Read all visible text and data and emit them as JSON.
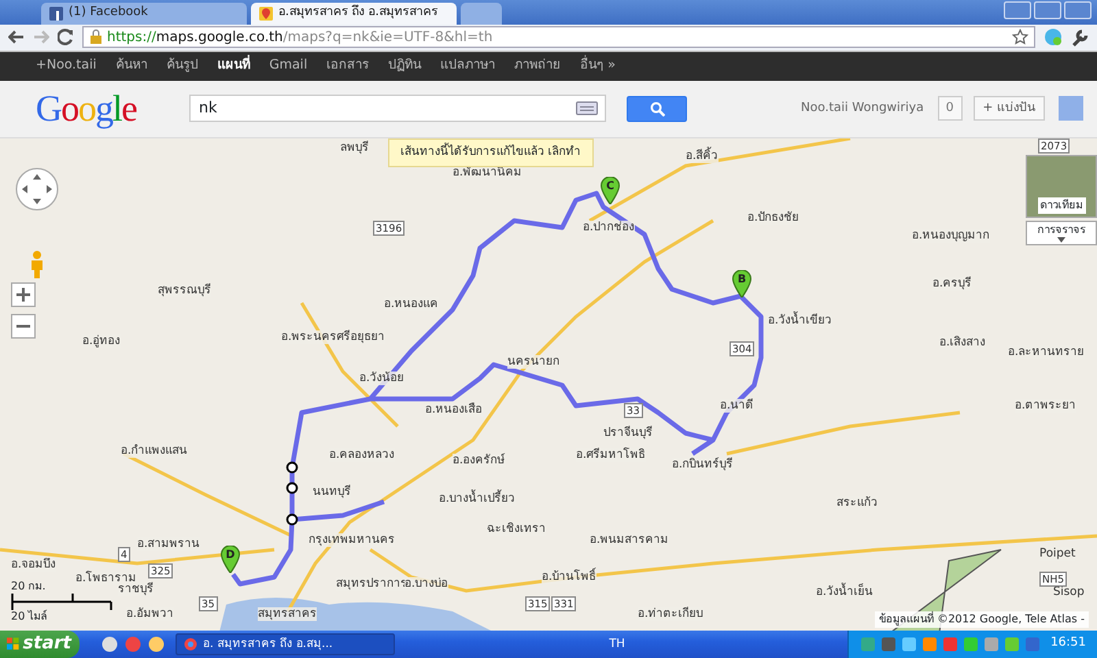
{
  "browser": {
    "tabs": [
      {
        "title": "(1) Facebook",
        "selected": false
      },
      {
        "title": "อ.สมุทรสาคร ถึง อ.สมุทรสาคร",
        "selected": true
      }
    ],
    "url": {
      "scheme": "https://",
      "host": "maps.google.co.th",
      "path": "/maps?q=nk&ie=UTF-8&hl=th"
    }
  },
  "google_bar": {
    "items": [
      {
        "label": "+Noo.taii",
        "selected": false
      },
      {
        "label": "ค้นหา",
        "selected": false
      },
      {
        "label": "ค้นรูป",
        "selected": false
      },
      {
        "label": "แผนที่",
        "selected": true
      },
      {
        "label": "Gmail",
        "selected": false
      },
      {
        "label": "เอกสาร",
        "selected": false
      },
      {
        "label": "ปฏิทิน",
        "selected": false
      },
      {
        "label": "แปลภาษา",
        "selected": false
      },
      {
        "label": "ภาพถ่าย",
        "selected": false
      },
      {
        "label": "อื่นๆ »",
        "selected": false
      }
    ]
  },
  "header": {
    "logo": "Google",
    "search": {
      "value": "nk"
    },
    "user_name": "Noo.taii Wongwiriya",
    "notification_count": "0",
    "share_button": "+ แบ่งปัน"
  },
  "map": {
    "notice": {
      "text": "เส้นทางนี้ได้รับการแก้ไขแล้ว",
      "link": "เลิกทำ"
    },
    "map_type": {
      "satellite": "ดาวเทียม",
      "traffic": "การจราจร"
    },
    "markers": [
      {
        "label": "C"
      },
      {
        "label": "B"
      },
      {
        "label": "D"
      }
    ],
    "labels": [
      {
        "kind": "place",
        "text": "ลพบุรี"
      },
      {
        "kind": "place",
        "text": "อ.พัฒนานิคม"
      },
      {
        "kind": "place",
        "text": "อ.ปากช่อง"
      },
      {
        "kind": "place",
        "text": "อ.สีคิ้ว"
      },
      {
        "kind": "place",
        "text": "อ.ปักธงชัย"
      },
      {
        "kind": "place",
        "text": "อ.หนองบุญมาก"
      },
      {
        "kind": "place",
        "text": "อ.วังน้ำเขียว"
      },
      {
        "kind": "place",
        "text": "อ.ครบุรี"
      },
      {
        "kind": "place",
        "text": "อ.เสิงสาง"
      },
      {
        "kind": "place",
        "text": "อ.ละหานทราย"
      },
      {
        "kind": "place",
        "text": "อ.ตาพระยา"
      },
      {
        "kind": "place",
        "text": "นครนายก"
      },
      {
        "kind": "place",
        "text": "ปราจีนบุรี"
      },
      {
        "kind": "place",
        "text": "อ.นาดี"
      },
      {
        "kind": "place",
        "text": "อ.กบินทร์บุรี"
      },
      {
        "kind": "place",
        "text": "อ.ศรีมหาโพธิ"
      },
      {
        "kind": "place",
        "text": "สระแก้ว"
      },
      {
        "kind": "place",
        "text": "อ.บางน้ำเปรี้ยว"
      },
      {
        "kind": "place",
        "text": "ฉะเชิงเทรา"
      },
      {
        "kind": "place",
        "text": "นนทบุรี"
      },
      {
        "kind": "place",
        "text": "กรุงเทพมหานคร"
      },
      {
        "kind": "place",
        "text": "สมุทรปราการ"
      },
      {
        "kind": "place",
        "text": "อ.บางบ่อ"
      },
      {
        "kind": "place",
        "text": "อ.คลองหลวง"
      },
      {
        "kind": "place",
        "text": "อ.หนองเสือ"
      },
      {
        "kind": "place",
        "text": "อ.องครักษ์"
      },
      {
        "kind": "place",
        "text": "อ.พระนครศรีอยุธยา"
      },
      {
        "kind": "place",
        "text": "อ.วังน้อย"
      },
      {
        "kind": "place",
        "text": "อ.หนองแค"
      },
      {
        "kind": "place",
        "text": "สุพรรณบุรี"
      },
      {
        "kind": "place",
        "text": "อ.อู่ทอง"
      },
      {
        "kind": "place",
        "text": "อ.กำแพงแสน"
      },
      {
        "kind": "place",
        "text": "อ.สามพราน"
      },
      {
        "kind": "place",
        "text": "อ.โพธาราม"
      },
      {
        "kind": "place",
        "text": "ราชบุรี"
      },
      {
        "kind": "place",
        "text": "อ.จอมบึง"
      },
      {
        "kind": "place",
        "text": "อ.อัมพวา"
      },
      {
        "kind": "place",
        "text": "สมุทรสาคร"
      },
      {
        "kind": "place",
        "text": "อ.บ้านโพธิ์"
      },
      {
        "kind": "place",
        "text": "อ.พนมสารคาม"
      },
      {
        "kind": "place",
        "text": "อ.ท่าตะเกียบ"
      },
      {
        "kind": "place",
        "text": "อ.วังน้ำเย็น"
      },
      {
        "kind": "place",
        "text": "Poipet"
      },
      {
        "kind": "place",
        "text": "Sisop"
      },
      {
        "kind": "shield",
        "text": "2073"
      },
      {
        "kind": "shield",
        "text": "3196"
      },
      {
        "kind": "shield",
        "text": "304"
      },
      {
        "kind": "shield",
        "text": "33"
      },
      {
        "kind": "shield",
        "text": "4"
      },
      {
        "kind": "shield",
        "text": "325"
      },
      {
        "kind": "shield",
        "text": "NH5"
      },
      {
        "kind": "shield",
        "text": "35"
      },
      {
        "kind": "shield",
        "text": "315"
      },
      {
        "kind": "shield",
        "text": "331"
      }
    ],
    "scale": {
      "metric": "20 กม.",
      "imperial": "20 ไมล์"
    },
    "copyright": "ข้อมูลแผนที่ ©2012 Google, Tele Atlas -"
  },
  "taskbar": {
    "start": "start",
    "tasks": [
      {
        "title": "อ. สมุทรสาคร ถึง อ.สมุ...",
        "selected": true
      }
    ],
    "language": "TH",
    "clock": "16:51"
  }
}
